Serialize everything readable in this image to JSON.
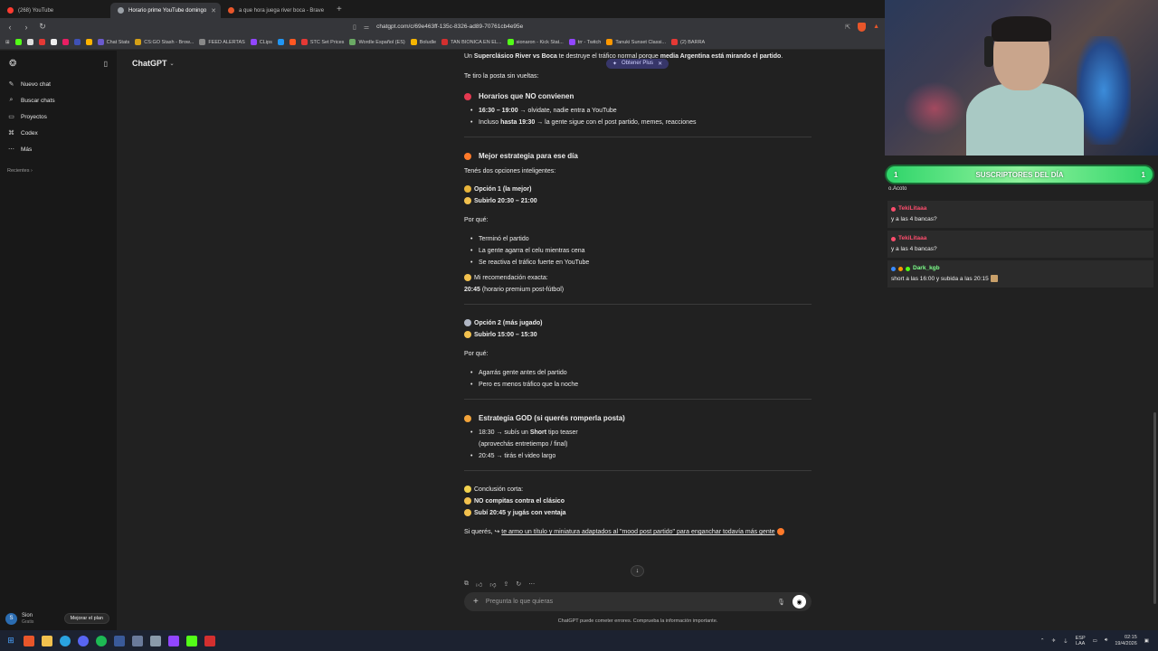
{
  "browser": {
    "tabs": [
      {
        "label": "(268) YouTube",
        "color": "#ff3b30",
        "active": false
      },
      {
        "label": "Horario prime YouTube domingo",
        "color": "#9aa0a6",
        "active": true
      },
      {
        "label": "a que hora juega river boca - Brave",
        "color": "#e8562a",
        "active": false
      }
    ],
    "url": "chatgpt.com/c/69e463ff-135c-8326-ad89-70761cb4e95e",
    "bookmarks": [
      {
        "label": "Chat Stats",
        "color": "#6a5acd"
      },
      {
        "label": "CS:GO Stash - Brow...",
        "color": "#d4a017"
      },
      {
        "label": "FEED ALERTAS",
        "color": "#888"
      },
      {
        "label": "CLips",
        "color": "#9146ff"
      },
      {
        "label": "STC Set Prices",
        "color": "#e53935"
      },
      {
        "label": "Wordle Español (ES)",
        "color": "#6aaa64"
      },
      {
        "label": "Boludle",
        "color": "#f4b400"
      },
      {
        "label": "TAN BIONICA EN EL...",
        "color": "#d32f2f"
      },
      {
        "label": "sionaron - Kick Stat...",
        "color": "#53fc18"
      },
      {
        "label": "trr - Twitch",
        "color": "#9146ff"
      },
      {
        "label": "Tanuki Sunset Classi...",
        "color": "#ff9800"
      },
      {
        "label": "(2) BARRA",
        "color": "#e53935"
      }
    ]
  },
  "sidebar": {
    "items": [
      {
        "label": "Nuevo chat",
        "icon": "compose-icon"
      },
      {
        "label": "Buscar chats",
        "icon": "search-icon"
      },
      {
        "label": "Proyectos",
        "icon": "folder-icon"
      },
      {
        "label": "Codex",
        "icon": "code-icon"
      },
      {
        "label": "Más",
        "icon": "more-icon"
      }
    ],
    "recents_label": "Recientes",
    "user": {
      "initial": "S",
      "name": "Sion",
      "plan": "Gratis"
    },
    "upgrade_label": "Mejorar el plan"
  },
  "header": {
    "model": "ChatGPT",
    "plus_label": "Obtener Plus"
  },
  "conversation": {
    "intro_a": "Un ",
    "intro_b": "Superclásico River vs Boca",
    "intro_c": " te destruye el tráfico normal porque ",
    "intro_d": "media Argentina está mirando el partido",
    "intro_e": ".",
    "lead": "Te tiro la posta sin vueltas:",
    "sec1_title": "Horarios que NO convienen",
    "sec1_items": [
      {
        "bold": "16:30 – 19:00",
        "text": " → olvidate, nadie entra a YouTube"
      },
      {
        "pre": "Incluso ",
        "bold": "hasta 19:30",
        "text": " → la gente sigue con el post partido, memes, reacciones"
      }
    ],
    "sec2_title": "Mejor estrategia para ese día",
    "sec2_lead": "Tenés dos opciones inteligentes:",
    "opt1_title": "Opción 1 (la mejor)",
    "opt1_time": "Subirlo 20:30 – 21:00",
    "why_label": "Por qué:",
    "opt1_reasons": [
      "Terminó el partido",
      "La gente agarra el celu mientras cena",
      "Se reactiva el tráfico fuerte en YouTube"
    ],
    "rec_label": "Mi recomendación exacta:",
    "rec_time": "20:45",
    "rec_note": " (horario premium post-fútbol)",
    "opt2_title": "Opción 2 (más jugado)",
    "opt2_time": "Subirlo 15:00 – 15:30",
    "opt2_reasons": [
      "Agarrás gente antes del partido",
      "Pero es menos tráfico que la noche"
    ],
    "sec3_title": "Estrategia GOD (si querés romperla posta)",
    "sec3_items": [
      {
        "pre": "18:30 → subís un ",
        "bold": "Short",
        "text": " tipo teaser"
      },
      {
        "pre": "(aprovechás entretiempo / final)",
        "bold": "",
        "text": ""
      },
      {
        "pre": "20:45 → tirás el video largo",
        "bold": "",
        "text": ""
      }
    ],
    "concl_label": "Conclusión corta:",
    "concl_1": "NO compitas contra el clásico",
    "concl_2": "Subí 20:45 y jugás con ventaja",
    "closing_pre": "Si querés, ",
    "closing_link": "te armo un título y miniatura adaptados al \"mood post partido\" para enganchar todavía más gente",
    "composer_placeholder": "Pregunta lo que quieras",
    "disclaimer": "ChatGPT puede cometer errores. Comprueba la información importante."
  },
  "stream": {
    "subs_count_left": "1",
    "subs_label": "SUSCRIPTORES DEL DÍA",
    "subs_count_right": "1",
    "chat_cut": "o.Acoto",
    "messages": [
      {
        "user": "TekiLitaaa",
        "color": "#ff4d6d",
        "text": "y a las 4 bancas?"
      },
      {
        "user": "TekiLitaaa",
        "color": "#ff4d6d",
        "text": "y a las 4 bancas?"
      },
      {
        "user": "Dark_kgb",
        "color": "#7cff8a",
        "text": "short a las 16:00 y subida a las 20:15"
      }
    ]
  },
  "taskbar": {
    "lang_1": "ESP",
    "lang_2": "LAA",
    "time": "02:15",
    "date": "19/4/2026"
  }
}
